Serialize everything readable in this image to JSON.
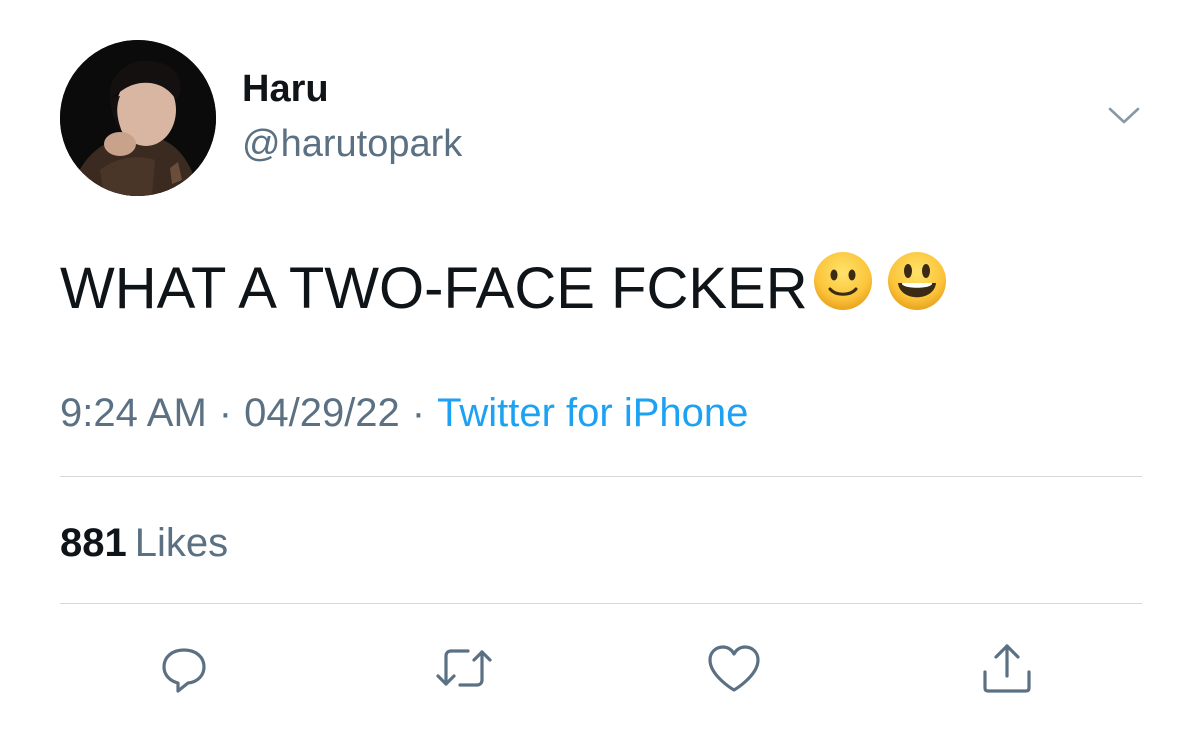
{
  "tweet": {
    "display_name": "Haru",
    "handle": "@harutopark",
    "text": "WHAT A TWO-FACE FCKER",
    "emojis": [
      "slightly-smiling-face-emoji",
      "grinning-face-with-big-eyes-emoji"
    ],
    "time": "9:24 AM",
    "date": "04/29/22",
    "separator": "·",
    "source": "Twitter for iPhone",
    "likes_count": "881",
    "likes_label": "Likes"
  },
  "icons": {
    "more": "chevron-down-icon",
    "reply": "reply-icon",
    "retweet": "retweet-icon",
    "like": "heart-icon",
    "share": "share-icon"
  },
  "colors": {
    "text": "#0f1419",
    "secondary": "#5b7083",
    "link": "#1da1f2",
    "divider": "#d6d9dc"
  }
}
